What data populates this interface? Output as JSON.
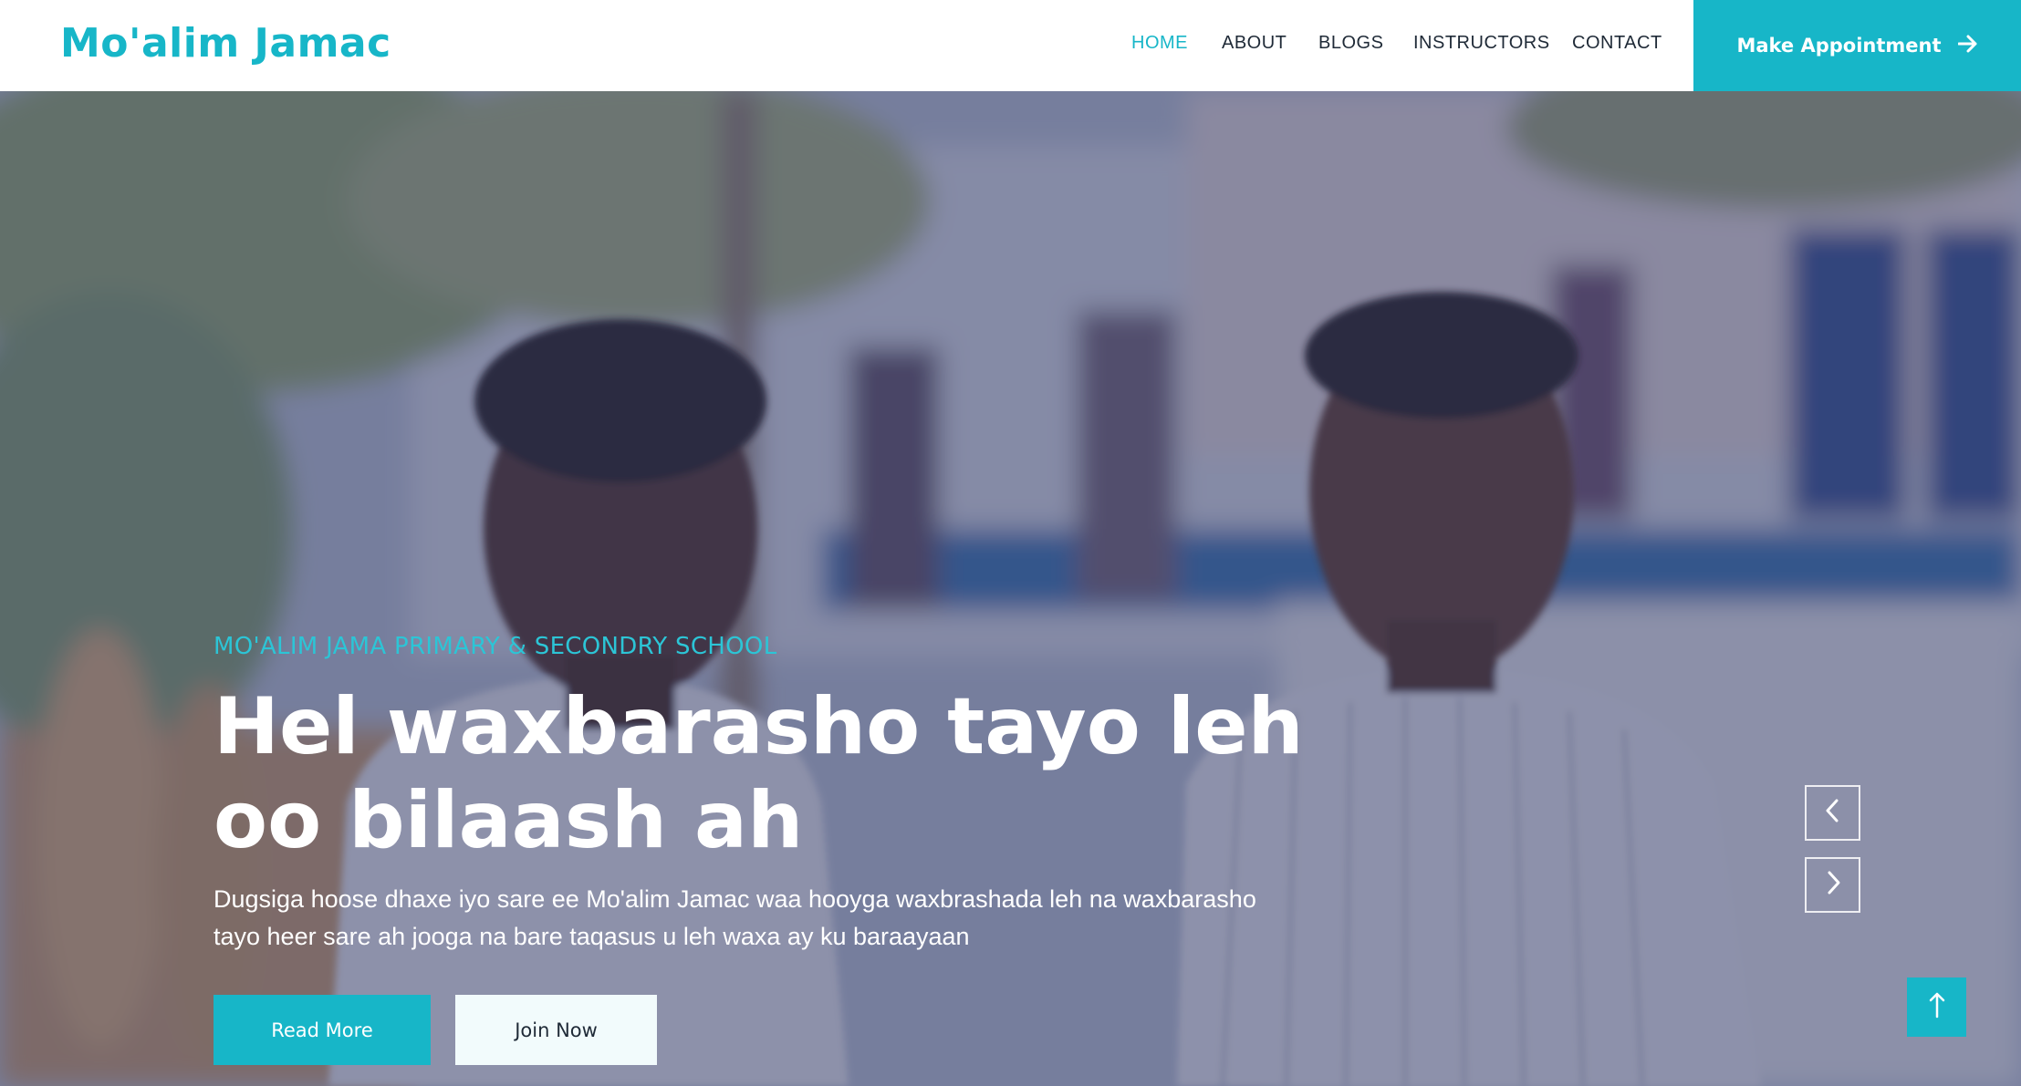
{
  "header": {
    "logo": "Mo'alim Jamac",
    "nav": [
      {
        "label": "HOME",
        "active": true
      },
      {
        "label": "ABOUT",
        "active": false
      },
      {
        "label": "BLOGS",
        "active": false
      },
      {
        "label": "INSTRUCTORS",
        "active": false
      },
      {
        "label": "CONTACT",
        "active": false
      }
    ],
    "cta_label": "Make Appointment",
    "cta_icon": "arrow-right-icon"
  },
  "hero": {
    "subtitle": "MO'ALIM JAMA PRIMARY & SECONDRY SCHOOL",
    "headline": "Hel waxbarasho tayo leh oo bilaash ah",
    "description": "Dugsiga hoose dhaxe iyo sare ee Mo'alim Jamac waa hooyga waxbrashada leh na waxbarasho tayo heer sare ah jooga na bare taqasus u leh waxa ay ku baraayaan",
    "read_more_label": "Read More",
    "join_now_label": "Join Now",
    "prev_icon": "chevron-left-icon",
    "next_icon": "chevron-right-icon",
    "scroll_top_icon": "arrow-up-icon"
  },
  "colors": {
    "accent": "#17b6c8",
    "overlay": "#3a3f69",
    "text_dark": "#1f2a37",
    "white": "#ffffff"
  }
}
